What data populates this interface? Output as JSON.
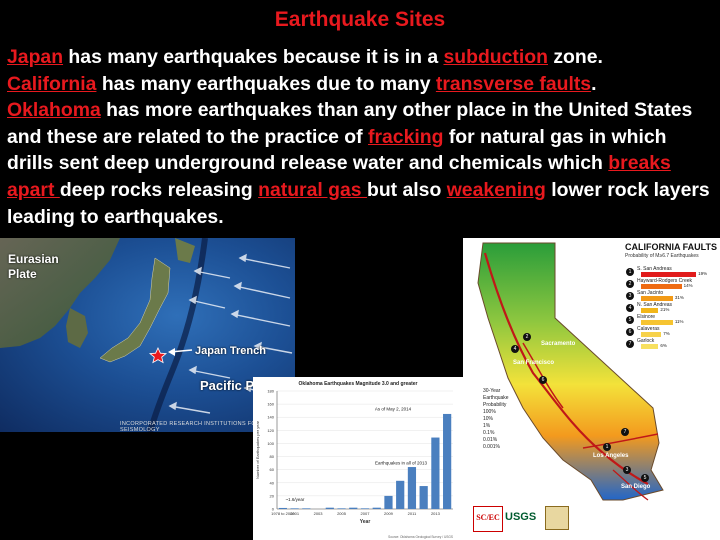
{
  "title": "Earthquake Sites",
  "paragraph": {
    "s1_link": "Japan",
    "s1_a": " has many earthquakes because it is in a ",
    "s1_link2": "subduction",
    "s1_b": " zone.",
    "s2_link": "California",
    "s2_a": " has many earthquakes due to many ",
    "s2_link2": "transverse faults",
    "s2_b": ".",
    "s3_link": "Oklahoma",
    "s3_a": " has more earthquakes than any other place in the United States and these are related to the practice of ",
    "s3_link2": "fracking",
    "s3_b": " for natural gas in which drills sent deep underground release water and chemicals which ",
    "s3_link3": "breaks apart ",
    "s3_c": "deep rocks releasing ",
    "s3_link4": "natural gas ",
    "s3_d": "but also ",
    "s3_link5": "weakening",
    "s3_e": " lower rock layers leading to earthquakes."
  },
  "japan_map": {
    "plate_top_1": "Eurasian",
    "plate_top_2": "Plate",
    "trench_label": "Japan Trench",
    "plate_bottom": "Pacific Pl",
    "credit": "INCORPORATED RESEARCH INSTITUTIONS FOR SEISMOLOGY"
  },
  "chart_data": {
    "type": "bar",
    "title": "Oklahoma Earthquakes Magnitude 3.0 and greater",
    "xlabel": "Year",
    "ylabel": "Number of Earthquakes per year",
    "ylim": [
      0,
      180
    ],
    "yticks": [
      0,
      20,
      40,
      60,
      80,
      100,
      120,
      140,
      160,
      180
    ],
    "xtick_labels": [
      "1978 to 2008",
      "2001",
      "2003",
      "2005",
      "2007",
      "2009",
      "2011",
      "2013"
    ],
    "categories": [
      "1978-2008",
      "2001",
      "2002",
      "2003",
      "2004",
      "2005",
      "2006",
      "2007",
      "2008",
      "2009",
      "2010",
      "2011",
      "2012",
      "2013",
      "2014"
    ],
    "values": [
      1.6,
      1,
      1,
      0,
      2,
      1,
      2,
      1,
      2,
      20,
      43,
      64,
      35,
      109,
      145
    ],
    "annotations": [
      "As of May 2, 2014",
      "Earthquakes in all of 2013",
      "~1.6/year"
    ],
    "source": "Source: Oklahoma Geological Survey / USGS"
  },
  "california_map": {
    "title": "CALIFORNIA FAULTS",
    "subtitle": "Probability of M≥6.7 Earthquakes",
    "faults": [
      {
        "num": "1",
        "name": "S. San Andreas",
        "pct": "19%",
        "value": 19,
        "color": "#e11b1b"
      },
      {
        "num": "2",
        "name": "Hayward-Rodgers Creek",
        "pct": "14%",
        "value": 14,
        "color": "#ef6b12"
      },
      {
        "num": "3",
        "name": "San Jacinto",
        "pct": "31%",
        "value": 11,
        "color": "#f29a17"
      },
      {
        "num": "4",
        "name": "N. San Andreas",
        "pct": "21%",
        "value": 6,
        "color": "#f2b61a"
      },
      {
        "num": "5",
        "name": "Elsinore",
        "pct": "11%",
        "value": 11,
        "color": "#f6c431"
      },
      {
        "num": "6",
        "name": "Calaveras",
        "pct": "7%",
        "value": 7,
        "color": "#f7d24a"
      },
      {
        "num": "7",
        "name": "Garlock",
        "pct": "6%",
        "value": 6,
        "color": "#f7e05f"
      }
    ],
    "prob_legend_title_1": "30-Year",
    "prob_legend_title_2": "Earthquake",
    "prob_legend_title_3": "Probability",
    "prob_levels": [
      "100%",
      "10%",
      "1%",
      "0.1%",
      "0.01%",
      "0.001%"
    ],
    "cities": [
      "Sacramento",
      "San Francisco",
      "Los Angeles",
      "San Diego"
    ],
    "logos": [
      "SC/EC",
      "USGS"
    ]
  }
}
